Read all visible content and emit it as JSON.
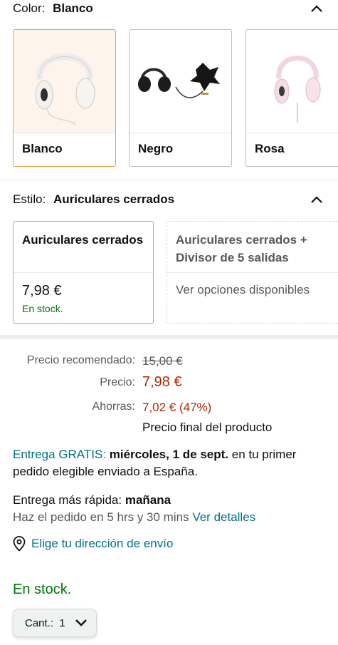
{
  "color": {
    "label": "Color:",
    "selected": "Blanco",
    "options": [
      {
        "name": "Blanco"
      },
      {
        "name": "Negro"
      },
      {
        "name": "Rosa"
      }
    ]
  },
  "style": {
    "label": "Estilo:",
    "selected": "Auriculares cerrados",
    "options": [
      {
        "title": "Auriculares cerrados",
        "price": "7,98 €",
        "stock": "En stock."
      },
      {
        "title": "Auriculares cerrados + Divisor de 5 salidas",
        "info": "Ver opciones disponibles"
      }
    ]
  },
  "pricing": {
    "rrp_label": "Precio recomendado:",
    "rrp_value": "15,00 €",
    "price_label": "Precio:",
    "price_value": "7,98 €",
    "savings_label": "Ahorras:",
    "savings_value": "7,02 € (47%)",
    "final_note": "Precio final del producto"
  },
  "delivery": {
    "free_label": "Entrega GRATIS:",
    "free_date": "miércoles, 1 de sept.",
    "free_rest": "en tu primer pedido elegible enviado a España.",
    "fast_label": "Entrega más rápida:",
    "fast_day": "mañana",
    "order_within": "Haz el pedido en 5 hrs y 30 mins",
    "details_link": "Ver detalles",
    "address_link": "Elige tu dirección de envío"
  },
  "availability": "En stock.",
  "quantity": {
    "label": "Cant.:",
    "value": "1"
  },
  "colors": {
    "accent_border": "#e0a53f",
    "link": "#007185",
    "price_red": "#b12704",
    "stock_green": "#007600"
  }
}
